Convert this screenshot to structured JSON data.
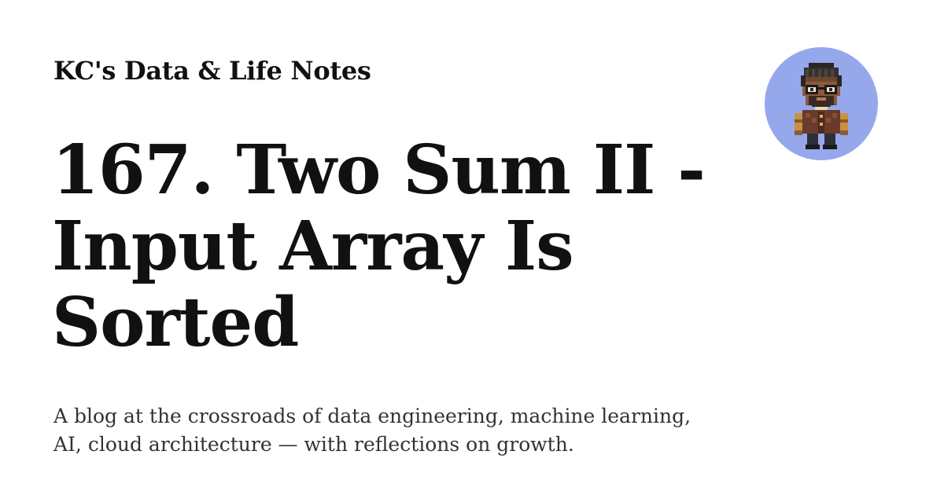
{
  "site": {
    "name": "KC's Data & Life Notes"
  },
  "post": {
    "title": "167. Two Sum II - Input Array Is Sorted",
    "description": "A blog at the crossroads of data engineering, machine learning, AI, cloud architecture — with reflections on growth."
  },
  "avatar": {
    "icon": "pixel-character-avatar",
    "background_color": "#96a8ec"
  }
}
